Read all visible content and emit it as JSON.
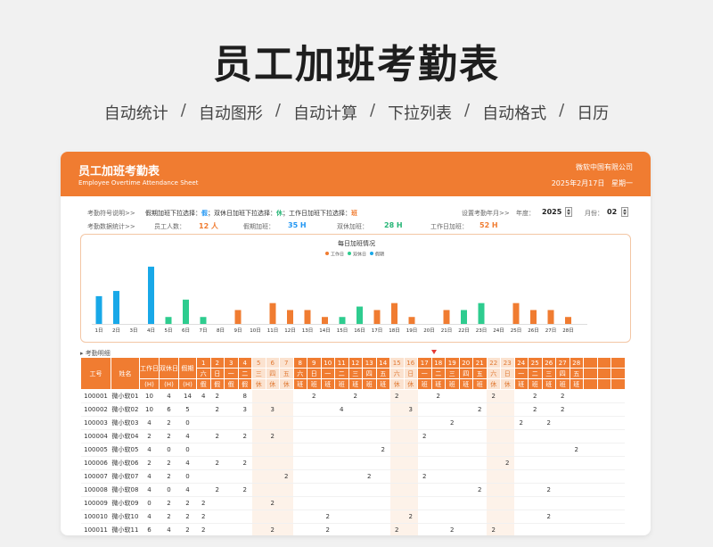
{
  "page": {
    "title": "员工加班考勤表",
    "features": [
      "自动统计",
      "自动图形",
      "自动计算",
      "下拉列表",
      "自动格式",
      "日历"
    ]
  },
  "sheet": {
    "title": "员工加班考勤表",
    "subtitle": "Employee Overtime Attendance Sheet",
    "company": "微软中国有限公司",
    "date": "2025年2月17日",
    "weekday": "星期一"
  },
  "info": {
    "symbol_label": "考勤符号说明>>",
    "symbol_text": "假期加班下拉选择：",
    "symbol_hol": "假",
    "symbol_text2": "；双休日加班下拉选择：",
    "symbol_wk": "休",
    "symbol_text3": "；工作日加班下拉选择：",
    "symbol_ot": "班",
    "month_label": "设置考勤年月>>",
    "year_label": "年度：",
    "year_value": "2025",
    "month_unit": "月份：",
    "month_value": "02",
    "stats_label": "考勤数据统计>>",
    "staff_label": "员工人数：",
    "staff_value": "12 人",
    "holiday_label": "假期加班：",
    "holiday_value": "35 H",
    "weekend_label": "双休加班：",
    "weekend_value": "28 H",
    "workday_label": "工作日加班：",
    "workday_value": "52 H"
  },
  "colors": {
    "workday": "#f07c31",
    "weekend": "#2ecc8f",
    "holiday": "#18a8e8",
    "header": "#f07c31"
  },
  "chart_data": {
    "type": "bar",
    "title": "每日加班情况",
    "legend": [
      "工作日",
      "双休日",
      "假期"
    ],
    "legend_position": "top",
    "categories": [
      "1日",
      "2日",
      "3日",
      "4日",
      "5日",
      "6日",
      "7日",
      "8日",
      "9日",
      "10日",
      "11日",
      "12日",
      "13日",
      "14日",
      "15日",
      "16日",
      "17日",
      "18日",
      "19日",
      "20日",
      "21日",
      "22日",
      "23日",
      "24日",
      "25日",
      "26日",
      "27日",
      "28日"
    ],
    "kinds": [
      "holiday",
      "holiday",
      "holiday",
      "holiday",
      "weekend",
      "weekend",
      "weekend",
      "workday",
      "workday",
      "workday",
      "workday",
      "workday",
      "workday",
      "workday",
      "weekend",
      "weekend",
      "workday",
      "workday",
      "workday",
      "workday",
      "workday",
      "weekend",
      "weekend",
      "workday",
      "workday",
      "workday",
      "workday",
      "workday"
    ],
    "values": [
      16,
      19,
      0,
      33,
      4,
      14,
      4,
      0,
      8,
      0,
      12,
      8,
      8,
      4,
      4,
      10,
      8,
      12,
      4,
      0,
      8,
      8,
      12,
      0,
      12,
      8,
      8,
      4
    ],
    "ylim": [
      0,
      36
    ],
    "grid": false
  },
  "table": {
    "section_label": "考勤明细",
    "headers": {
      "id": "工号",
      "name": "姓名",
      "workday": "工作日",
      "weekend": "双休日",
      "holiday": "假期",
      "unit": "(H)"
    },
    "days": [
      "1",
      "2",
      "3",
      "4",
      "5",
      "6",
      "7",
      "8",
      "9",
      "10",
      "11",
      "12",
      "13",
      "14",
      "15",
      "16",
      "17",
      "18",
      "19",
      "20",
      "21",
      "22",
      "23",
      "24",
      "25",
      "26",
      "27",
      "28"
    ],
    "weekdays": [
      "六",
      "日",
      "一",
      "二",
      "三",
      "四",
      "五",
      "六",
      "日",
      "一",
      "二",
      "三",
      "四",
      "五",
      "六",
      "日",
      "一",
      "二",
      "三",
      "四",
      "五",
      "六",
      "日",
      "一",
      "二",
      "三",
      "四",
      "五"
    ],
    "types": [
      "假",
      "假",
      "假",
      "假",
      "休",
      "休",
      "休",
      "班",
      "班",
      "班",
      "班",
      "班",
      "班",
      "班",
      "休",
      "休",
      "班",
      "班",
      "班",
      "班",
      "班",
      "休",
      "休",
      "班",
      "班",
      "班",
      "班",
      "班"
    ],
    "rows": [
      {
        "id": "100001",
        "name": "微小软01",
        "wd": "10",
        "we": "4",
        "ho": "14",
        "cells": {
          "1": "4",
          "2": "2",
          "4": "8",
          "9": "2",
          "12": "2",
          "15": "2",
          "18": "2",
          "22": "2",
          "25": "2",
          "27": "2"
        }
      },
      {
        "id": "100002",
        "name": "微小软02",
        "wd": "10",
        "we": "6",
        "ho": "5",
        "cells": {
          "2": "2",
          "4": "3",
          "6": "3",
          "11": "4",
          "16": "3",
          "21": "2",
          "25": "2",
          "27": "2"
        }
      },
      {
        "id": "100003",
        "name": "微小软03",
        "wd": "4",
        "we": "2",
        "ho": "0",
        "cells": {
          "19": "2",
          "24": "2",
          "26": "2"
        }
      },
      {
        "id": "100004",
        "name": "微小软04",
        "wd": "2",
        "we": "2",
        "ho": "4",
        "cells": {
          "2": "2",
          "4": "2",
          "6": "2",
          "17": "2"
        }
      },
      {
        "id": "100005",
        "name": "微小软05",
        "wd": "4",
        "we": "0",
        "ho": "0",
        "cells": {
          "14": "2",
          "28": "2"
        }
      },
      {
        "id": "100006",
        "name": "微小软06",
        "wd": "2",
        "we": "2",
        "ho": "4",
        "cells": {
          "2": "2",
          "4": "2",
          "23": "2"
        }
      },
      {
        "id": "100007",
        "name": "微小软07",
        "wd": "4",
        "we": "2",
        "ho": "0",
        "cells": {
          "7": "2",
          "13": "2",
          "17": "2"
        }
      },
      {
        "id": "100008",
        "name": "微小软08",
        "wd": "4",
        "we": "0",
        "ho": "4",
        "cells": {
          "2": "2",
          "4": "2",
          "21": "2",
          "26": "2"
        }
      },
      {
        "id": "100009",
        "name": "微小软09",
        "wd": "0",
        "we": "2",
        "ho": "2",
        "cells": {
          "1": "2",
          "6": "2"
        }
      },
      {
        "id": "100010",
        "name": "微小软10",
        "wd": "4",
        "we": "2",
        "ho": "2",
        "cells": {
          "1": "2",
          "10": "2",
          "16": "2",
          "26": "2"
        }
      },
      {
        "id": "100011",
        "name": "微小软11",
        "wd": "6",
        "we": "4",
        "ho": "2",
        "cells": {
          "1": "2",
          "6": "2",
          "10": "2",
          "15": "2",
          "19": "2",
          "22": "2"
        }
      }
    ]
  }
}
